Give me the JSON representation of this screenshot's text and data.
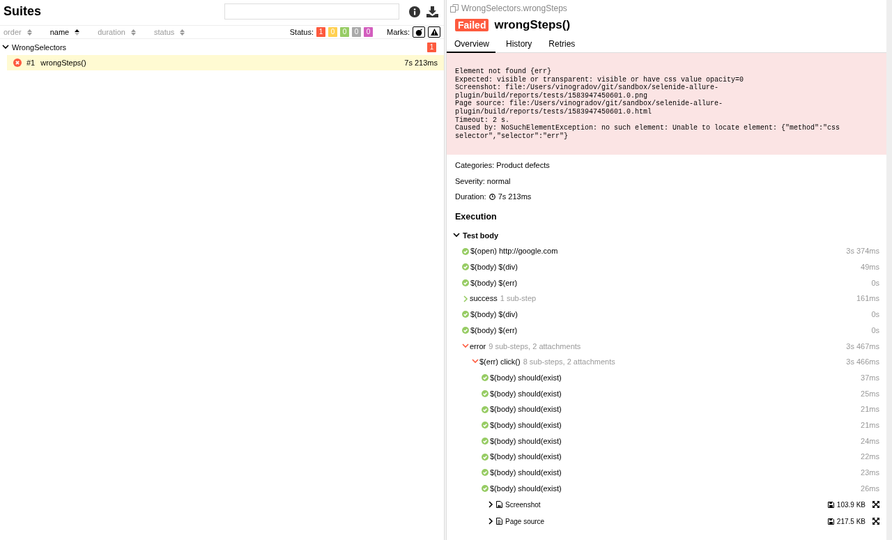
{
  "suites_pane": {
    "title": "Suites",
    "sorters": [
      {
        "label": "order",
        "selected": false
      },
      {
        "label": "name",
        "selected": true
      },
      {
        "label": "duration",
        "selected": false
      },
      {
        "label": "status",
        "selected": false
      }
    ],
    "status_label": "Status:",
    "status_counts": [
      {
        "count": "1",
        "color": "#fd5a3e"
      },
      {
        "count": "0",
        "color": "#ffd050"
      },
      {
        "count": "0",
        "color": "#97cc64"
      },
      {
        "count": "0",
        "color": "#aaaaaa"
      },
      {
        "count": "0",
        "color": "#d35ebe"
      }
    ],
    "marks_label": "Marks:",
    "groups": [
      {
        "name": "WrongSelectors",
        "expanded": true,
        "count": "1",
        "color": "#fd5a3e",
        "tests": [
          {
            "failed": true,
            "order": "#1",
            "name": "wrongSteps()",
            "duration": "7s 213ms",
            "selected": true
          }
        ]
      }
    ]
  },
  "test_pane": {
    "breadcrumb": "WrongSelectors.wrongSteps",
    "failed": true,
    "status_label": "Failed",
    "title": "wrongSteps()",
    "tabs": [
      {
        "label": "Overview",
        "selected": true
      },
      {
        "label": "History",
        "selected": false
      },
      {
        "label": "Retries",
        "selected": false
      }
    ],
    "error_message": "Element not found {err}\nExpected: visible or transparent: visible or have css value opacity=0\nScreenshot: file:/Users/vinogradov/git/sandbox/selenide-allure-\nplugin/build/reports/tests/1583947450601.0.png\nPage source: file:/Users/vinogradov/git/sandbox/selenide-allure-\nplugin/build/reports/tests/1583947450601.0.html\nTimeout: 2 s.\nCaused by: NoSuchElementException: no such element: Unable to locate element: {\"method\":\"css\nselector\",\"selector\":\"err\"}",
    "categories": "Categories: Product defects",
    "severity": "Severity: normal",
    "duration_label": "Duration:",
    "duration": "7s 213ms",
    "execution": {
      "title": "Execution",
      "body": {
        "name": "Test body",
        "expanded": true,
        "steps": [
          {
            "kind": "step",
            "failed": false,
            "name": "$(open) http://google.com",
            "time": "3s 374ms"
          },
          {
            "kind": "step",
            "failed": false,
            "name": "$(body) $(div)",
            "time": "49ms"
          },
          {
            "kind": "step",
            "failed": false,
            "name": "$(body) $(err)",
            "time": "0s"
          },
          {
            "kind": "group",
            "failed": false,
            "expanded": false,
            "name": "success",
            "meta": "1 sub-step",
            "time": "161ms"
          },
          {
            "kind": "step",
            "failed": false,
            "name": "$(body) $(div)",
            "time": "0s"
          },
          {
            "kind": "step",
            "failed": false,
            "name": "$(body) $(err)",
            "time": "0s"
          },
          {
            "kind": "group",
            "failed": true,
            "expanded": true,
            "name": "error",
            "meta": "9 sub-steps, 2 attachments",
            "time": "3s 467ms",
            "children": [
              {
                "kind": "group",
                "failed": true,
                "expanded": true,
                "name": "$(err) click()",
                "meta": "8 sub-steps, 2 attachments",
                "time": "3s 466ms",
                "children": [
                  {
                    "kind": "step",
                    "failed": false,
                    "name": "$(body) should(exist)",
                    "time": "37ms"
                  },
                  {
                    "kind": "step",
                    "failed": false,
                    "name": "$(body) should(exist)",
                    "time": "25ms"
                  },
                  {
                    "kind": "step",
                    "failed": false,
                    "name": "$(body) should(exist)",
                    "time": "21ms"
                  },
                  {
                    "kind": "step",
                    "failed": false,
                    "name": "$(body) should(exist)",
                    "time": "21ms"
                  },
                  {
                    "kind": "step",
                    "failed": false,
                    "name": "$(body) should(exist)",
                    "time": "24ms"
                  },
                  {
                    "kind": "step",
                    "failed": false,
                    "name": "$(body) should(exist)",
                    "time": "22ms"
                  },
                  {
                    "kind": "step",
                    "failed": false,
                    "name": "$(body) should(exist)",
                    "time": "23ms"
                  },
                  {
                    "kind": "step",
                    "failed": false,
                    "name": "$(body) should(exist)",
                    "time": "26ms"
                  },
                  {
                    "kind": "image",
                    "expanded": false,
                    "name": "Screenshot",
                    "size": "103.9 KB"
                  },
                  {
                    "kind": "text",
                    "expanded": false,
                    "name": "Page source",
                    "size": "217.5 KB"
                  }
                ]
              }
            ]
          }
        ]
      }
    }
  }
}
